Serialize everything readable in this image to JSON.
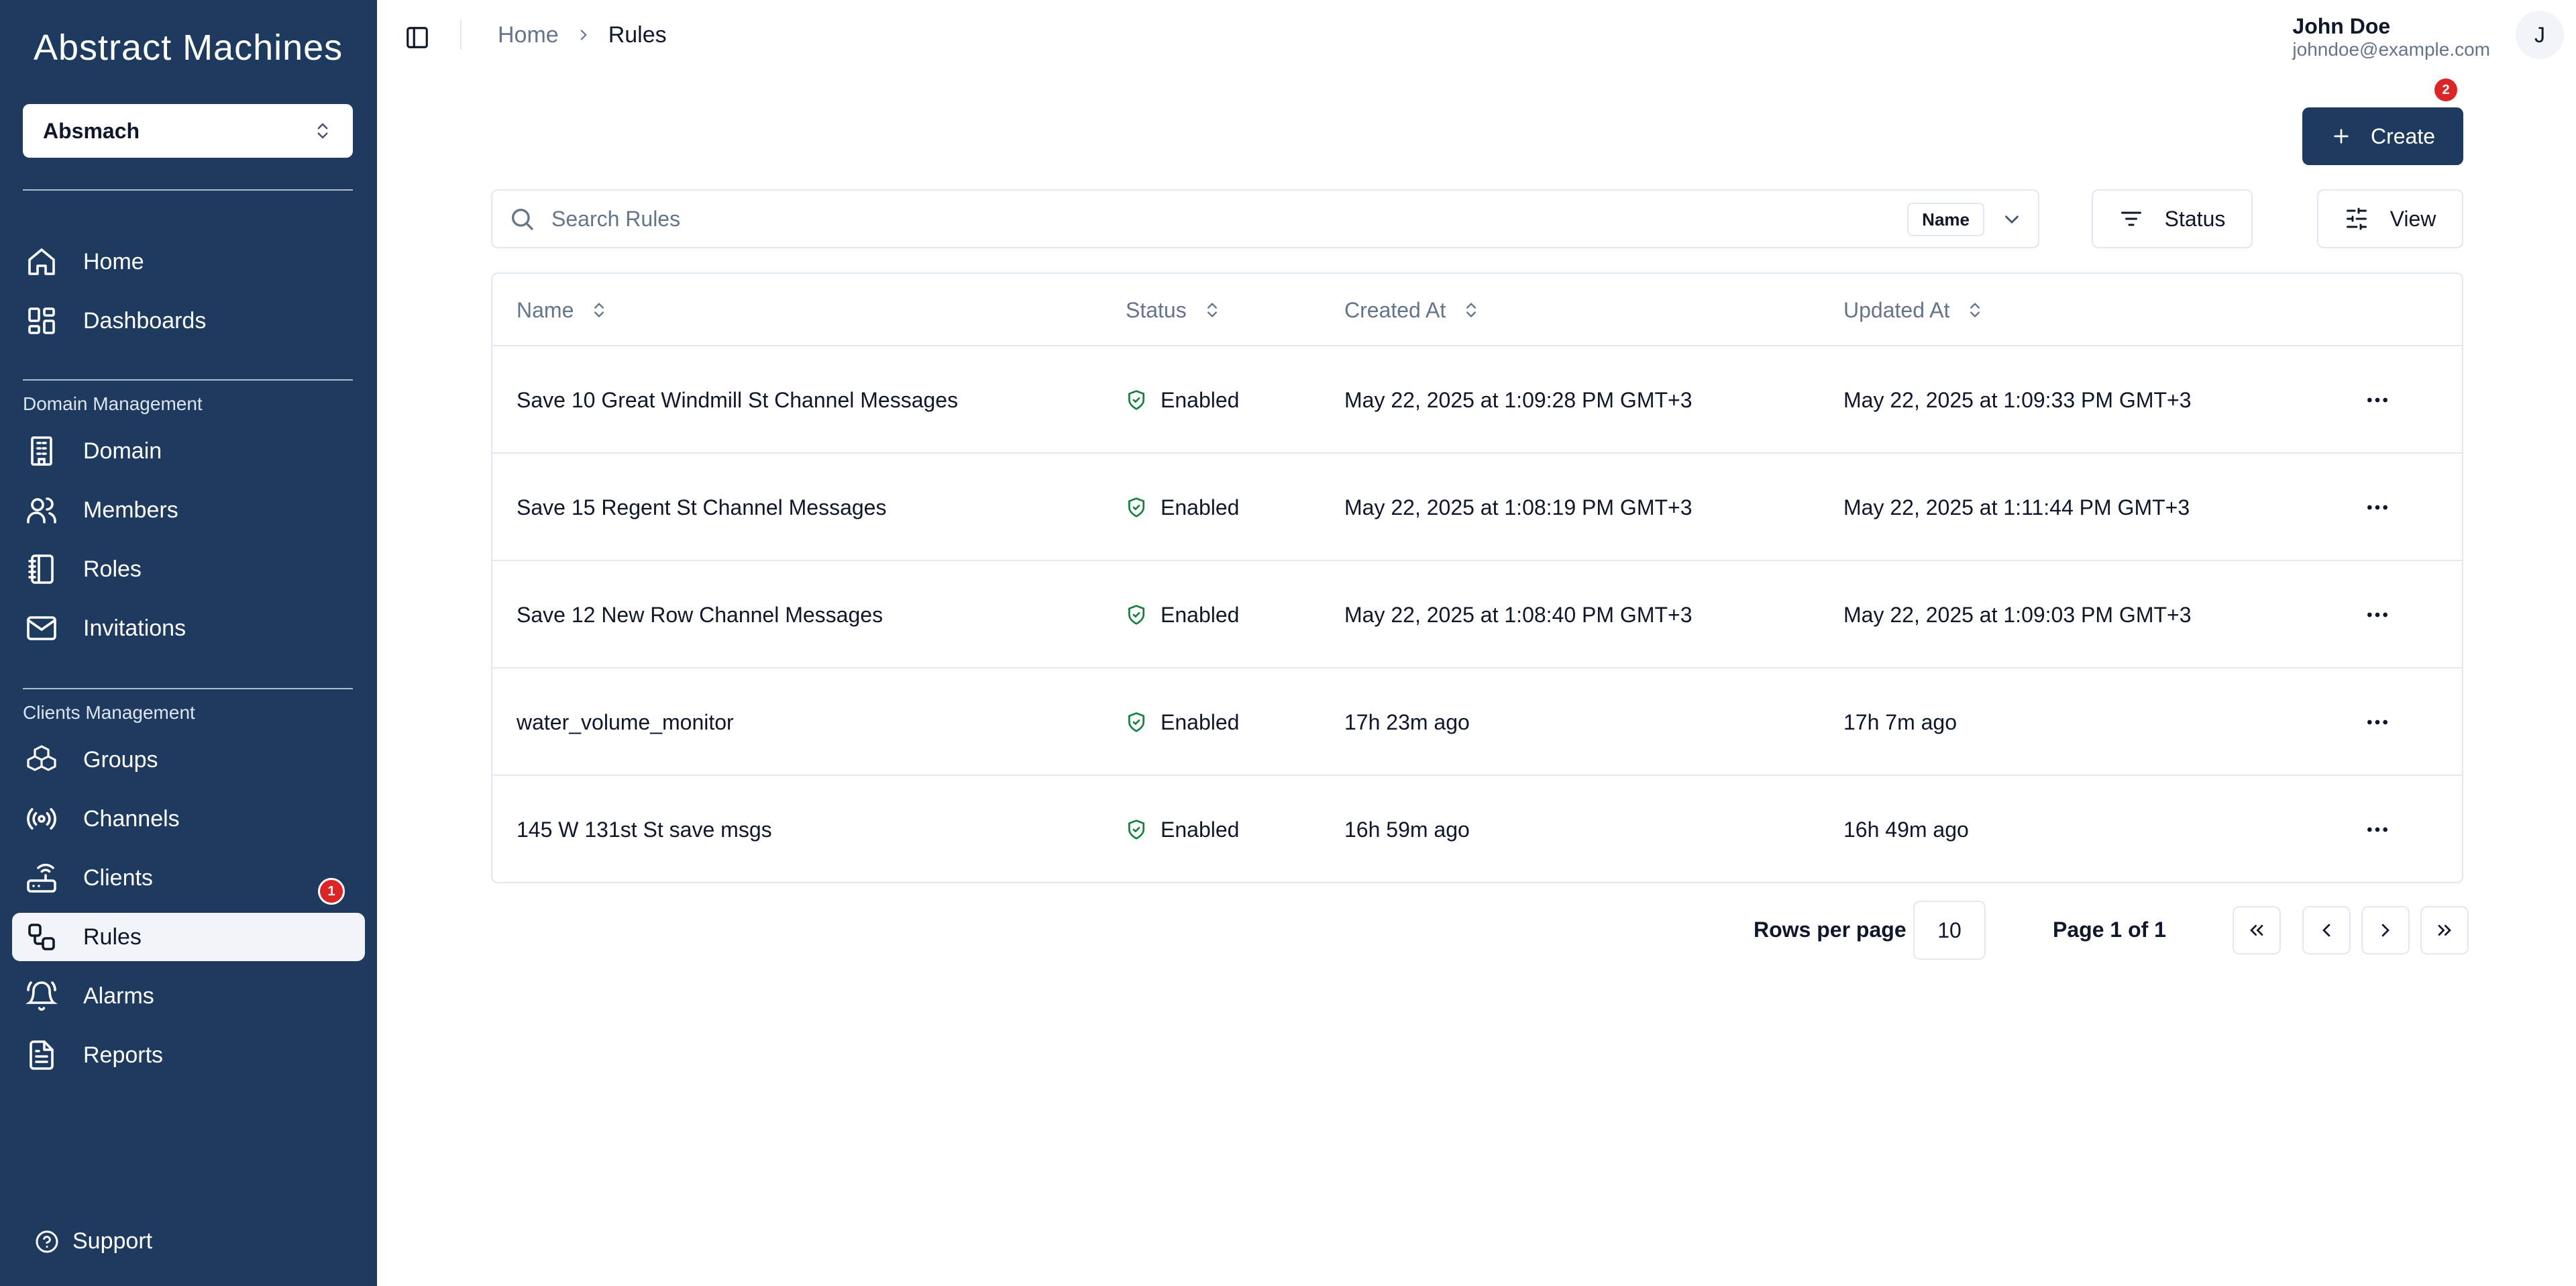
{
  "app": {
    "logo_text": "Abstract Machines",
    "org_selector": "Absmach"
  },
  "sidebar": {
    "items_top": [
      {
        "label": "Home",
        "icon": "home-icon"
      },
      {
        "label": "Dashboards",
        "icon": "dashboard-icon"
      }
    ],
    "domain_section_label": "Domain Management",
    "domain_items": [
      {
        "label": "Domain",
        "icon": "building-icon"
      },
      {
        "label": "Members",
        "icon": "users-icon"
      },
      {
        "label": "Roles",
        "icon": "notebook-icon"
      },
      {
        "label": "Invitations",
        "icon": "mail-icon"
      }
    ],
    "clients_section_label": "Clients Management",
    "clients_items": [
      {
        "label": "Groups",
        "icon": "boxes-icon"
      },
      {
        "label": "Channels",
        "icon": "radio-icon"
      },
      {
        "label": "Clients",
        "icon": "router-icon",
        "badge": "1"
      },
      {
        "label": "Rules",
        "icon": "workflow-icon",
        "active": true
      },
      {
        "label": "Alarms",
        "icon": "bell-ring-icon"
      },
      {
        "label": "Reports",
        "icon": "file-text-icon"
      }
    ],
    "support_label": "Support"
  },
  "header": {
    "breadcrumb_home": "Home",
    "breadcrumb_current": "Rules",
    "user_name": "John Doe",
    "user_email": "johndoe@example.com",
    "avatar_initial": "J"
  },
  "toolbar": {
    "create_label": "Create",
    "create_badge": "2",
    "search_placeholder": "Search Rules",
    "search_field_label": "Name",
    "status_label": "Status",
    "view_label": "View"
  },
  "table": {
    "columns": [
      "Name",
      "Status",
      "Created At",
      "Updated At"
    ],
    "rows": [
      {
        "name": "Save 10 Great Windmill St Channel Messages",
        "status": "Enabled",
        "created": "May 22, 2025 at 1:09:28 PM GMT+3",
        "updated": "May 22, 2025 at 1:09:33 PM GMT+3"
      },
      {
        "name": "Save 15 Regent St Channel Messages",
        "status": "Enabled",
        "created": "May 22, 2025 at 1:08:19 PM GMT+3",
        "updated": "May 22, 2025 at 1:11:44 PM GMT+3"
      },
      {
        "name": "Save 12 New Row Channel Messages",
        "status": "Enabled",
        "created": "May 22, 2025 at 1:08:40 PM GMT+3",
        "updated": "May 22, 2025 at 1:09:03 PM GMT+3"
      },
      {
        "name": "water_volume_monitor",
        "status": "Enabled",
        "created": "17h 23m ago",
        "updated": "17h 7m ago"
      },
      {
        "name": "145 W 131st St save msgs",
        "status": "Enabled",
        "created": "16h 59m ago",
        "updated": "16h 49m ago"
      }
    ]
  },
  "pagination": {
    "rows_per_page_label": "Rows per page",
    "rows_per_page_value": "10",
    "page_info": "Page 1 of 1"
  },
  "colors": {
    "sidebar_bg": "#1f3a5f",
    "primary": "#1f3a5f",
    "badge": "#dc2626",
    "status_enabled": "#15803d"
  }
}
